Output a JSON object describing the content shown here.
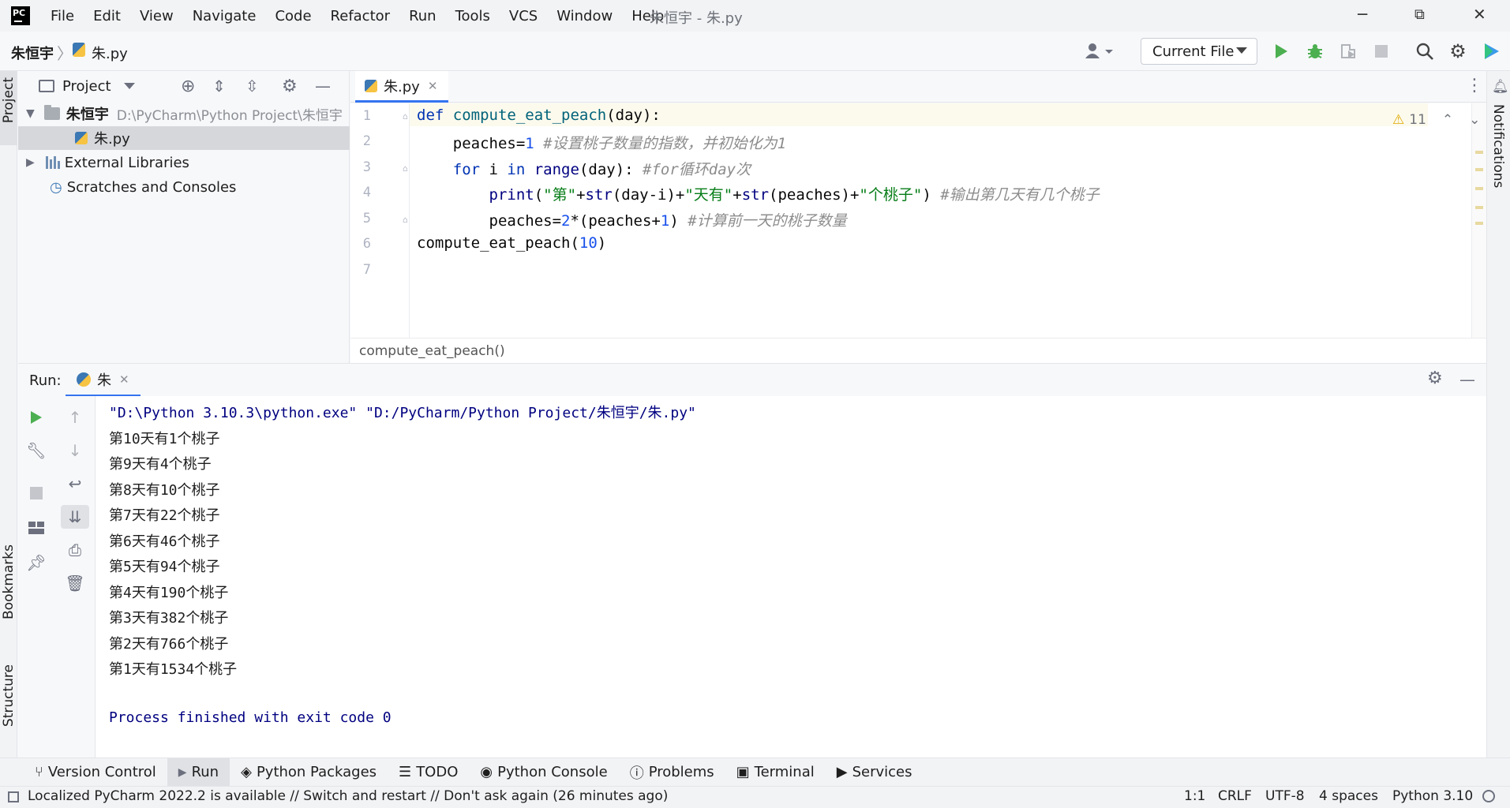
{
  "titlebar": {
    "menu": [
      "File",
      "Edit",
      "View",
      "Navigate",
      "Code",
      "Refactor",
      "Run",
      "Tools",
      "VCS",
      "Window",
      "Help"
    ],
    "window_title": "朱恒宇 - 朱.py",
    "minimize": "─",
    "restore": "⧉",
    "close": "✕"
  },
  "navbar": {
    "project": "朱恒宇",
    "file": "朱.py",
    "run_config": "Current File"
  },
  "left_stripe": {
    "project": "Project",
    "bookmarks": "Bookmarks",
    "structure": "Structure"
  },
  "right_stripe": {
    "notifications": "Notifications"
  },
  "project_panel": {
    "title": "Project",
    "root_name": "朱恒宇",
    "root_path": "D:\\PyCharm\\Python Project\\朱恒宇",
    "file": "朱.py",
    "external_libraries": "External Libraries",
    "scratches": "Scratches and Consoles"
  },
  "editor": {
    "tab": "朱.py",
    "warnings": "11",
    "line_numbers": [
      "1",
      "2",
      "3",
      "4",
      "5",
      "6",
      "7"
    ],
    "breadcrumb": "compute_eat_peach()",
    "code": {
      "l1_kw": "def ",
      "l1_fn": "compute_eat_peach",
      "l1_rest": "(day):",
      "l2_a": "    peaches=",
      "l2_num": "1",
      "l2_cmt": " #设置桃子数量的指数，并初始化为1",
      "l3_for": "    for",
      "l3_i": " i ",
      "l3_in": "in",
      "l3_range": " range",
      "l3_rest": "(day): ",
      "l3_cmt": "#for循环day次",
      "l4_indent": "        ",
      "l4_print": "print",
      "l4_p1": "(",
      "l4_s1": "\"第\"",
      "l4_p2": "+",
      "l4_str1": "str",
      "l4_p3": "(day-i)+",
      "l4_s2": "\"天有\"",
      "l4_p4": "+",
      "l4_str2": "str",
      "l4_p5": "(peaches)+",
      "l4_s3": "\"个桃子\"",
      "l4_p6": ") ",
      "l4_cmt": "#输出第几天有几个桃子",
      "l5_a": "        peaches=",
      "l5_num1": "2",
      "l5_b": "*(peaches+",
      "l5_num2": "1",
      "l5_c": ") ",
      "l5_cmt": "#计算前一天的桃子数量",
      "l6_a": "compute_eat_peach(",
      "l6_num": "10",
      "l6_b": ")"
    }
  },
  "run": {
    "label": "Run:",
    "tab": "朱",
    "command": "\"D:\\Python 3.10.3\\python.exe\" \"D:/PyCharm/Python Project/朱恒宇/朱.py\"",
    "output": [
      "第10天有1个桃子",
      "第9天有4个桃子",
      "第8天有10个桃子",
      "第7天有22个桃子",
      "第6天有46个桃子",
      "第5天有94个桃子",
      "第4天有190个桃子",
      "第3天有382个桃子",
      "第2天有766个桃子",
      "第1天有1534个桃子"
    ],
    "finished": "Process finished with exit code 0"
  },
  "toolwindows": [
    "Version Control",
    "Run",
    "Python Packages",
    "TODO",
    "Python Console",
    "Problems",
    "Terminal",
    "Services"
  ],
  "statusbar": {
    "message": "Localized PyCharm 2022.2 is available // Switch and restart // Don't ask again (26 minutes ago)",
    "position": "1:1",
    "line_sep": "CRLF",
    "encoding": "UTF-8",
    "indent": "4 spaces",
    "interpreter": "Python 3.10"
  },
  "colors": {
    "accent": "#3574f0",
    "run_green": "#4caf50",
    "keyword": "#0033b3",
    "string": "#067d17"
  }
}
